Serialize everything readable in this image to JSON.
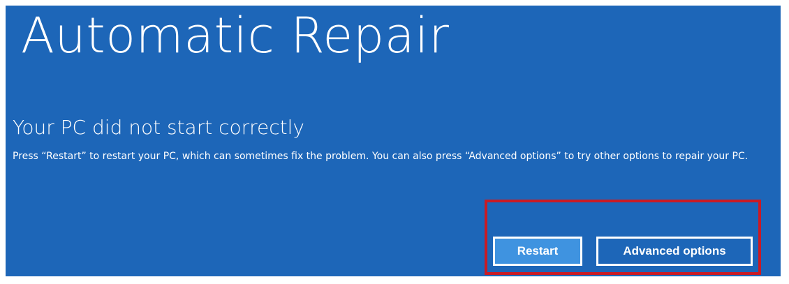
{
  "repair_screen": {
    "title": "Automatic Repair",
    "subtitle": "Your PC did not start correctly",
    "description": "Press “Restart” to restart your PC, which can sometimes fix the problem. You can also press “Advanced options” to try other options to repair your PC.",
    "buttons": {
      "restart": "Restart",
      "advanced_options": "Advanced options"
    },
    "colors": {
      "background": "#1d66b8",
      "restart_button": "#3f93e0",
      "highlight_border": "#c91b25",
      "text": "#ffffff"
    }
  }
}
